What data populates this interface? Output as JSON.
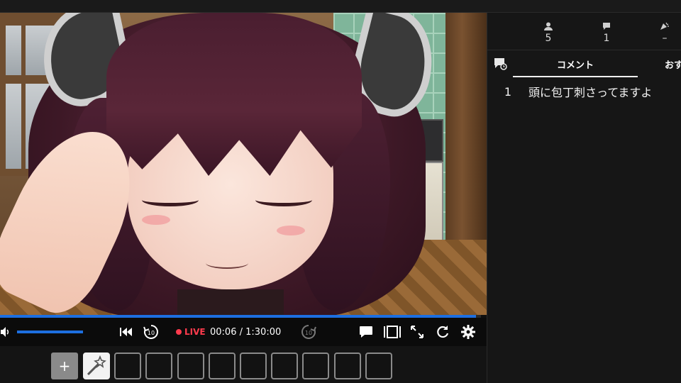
{
  "player": {
    "live_label": "LIVE",
    "current_time": "00:06",
    "separator": " / ",
    "duration": "1:30:00",
    "replay_seconds": "10",
    "forward_seconds": "10",
    "progress_fraction": 0.99,
    "volume_fraction": 1.0
  },
  "gift_bar": {
    "add_label": "+",
    "slot_count": 10
  },
  "stats": {
    "viewers": "5",
    "comments": "1",
    "ads": "–"
  },
  "tabs": {
    "comment_label": "コメント",
    "recommend_label": "おす"
  },
  "comments": [
    {
      "no": "1",
      "text": "頭に包丁刺さってますよ"
    }
  ],
  "colors": {
    "accent_blue": "#1d6fe0",
    "live_red": "#ff3b4d",
    "panel_bg": "#161616"
  },
  "icons": [
    "volume-icon",
    "skip-start-icon",
    "replay-10-icon",
    "forward-10-icon",
    "comment-icon",
    "layout-icon",
    "fullscreen-icon",
    "reload-icon",
    "gear-icon",
    "person-icon",
    "comment-count-icon",
    "party-popper-icon",
    "gift-wand-icon"
  ]
}
